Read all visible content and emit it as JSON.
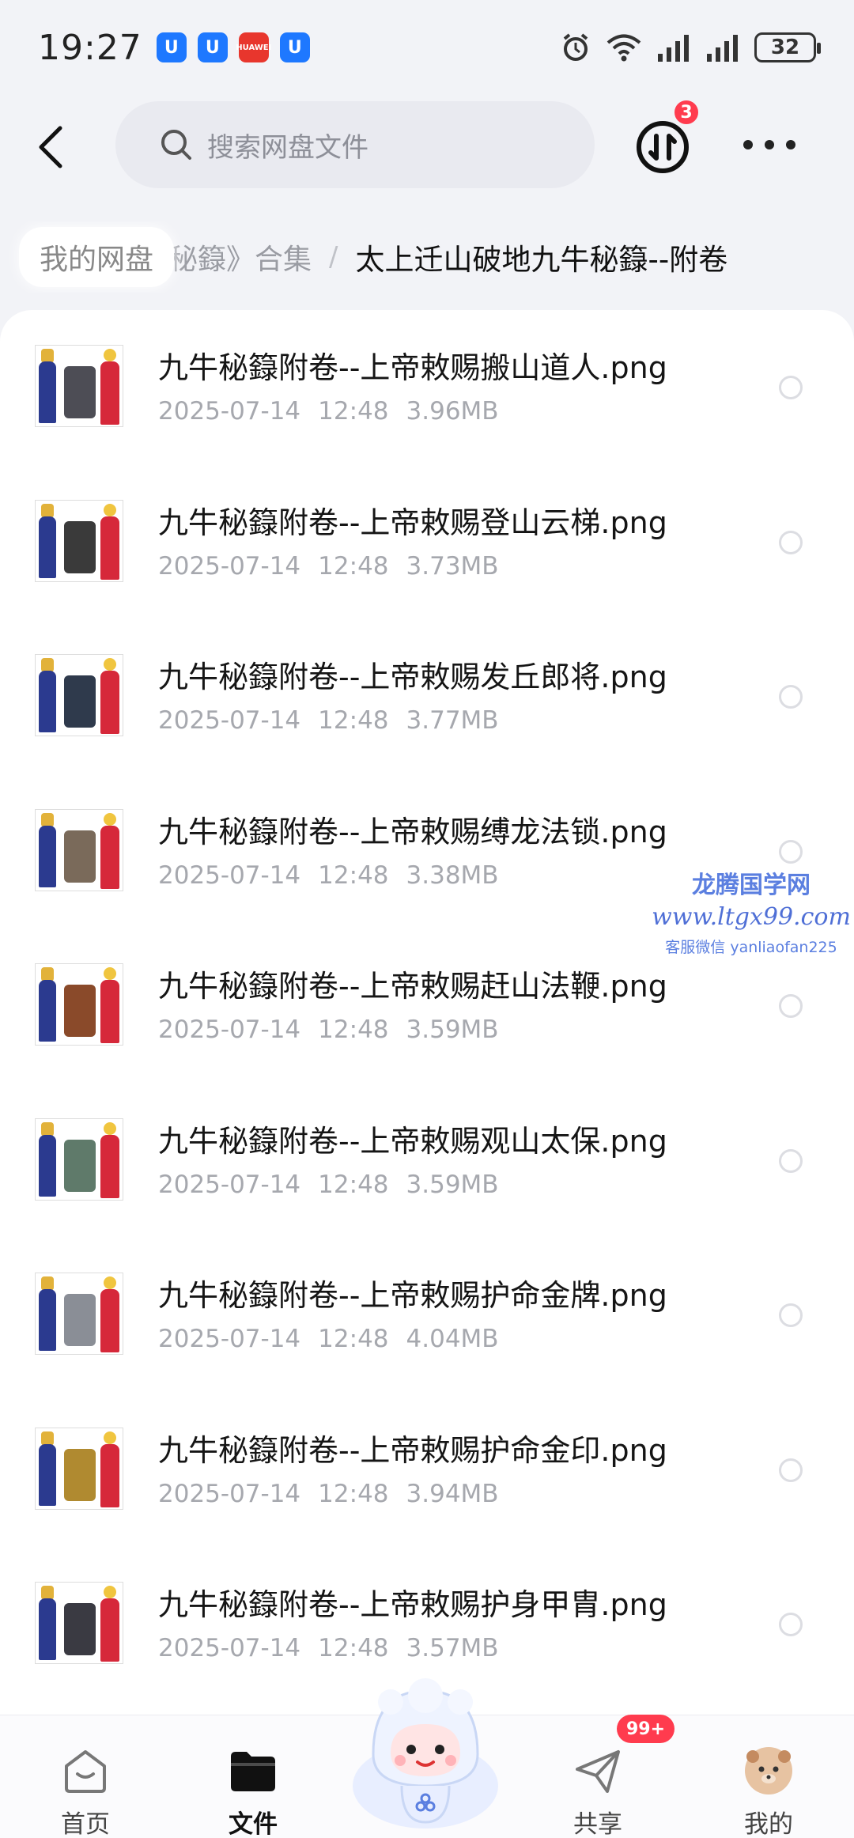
{
  "status_bar": {
    "time": "19:27",
    "battery": "32",
    "notif_labels": [
      "U",
      "U",
      "HUAWEI",
      "U"
    ]
  },
  "search": {
    "placeholder": "搜索网盘文件"
  },
  "transfer": {
    "badge": "3"
  },
  "breadcrumb": {
    "home": "我的网盘",
    "middle": "秘籙》合集",
    "separator": "/",
    "current": "太上迁山破地九牛秘籙--附卷"
  },
  "files": [
    {
      "name": "九牛秘籙附卷--上帝敕赐搬山道人.png",
      "date": "2025-07-14",
      "time": "12:48",
      "size": "3.96MB",
      "obj_color": "#4d4d55"
    },
    {
      "name": "九牛秘籙附卷--上帝敕赐登山云梯.png",
      "date": "2025-07-14",
      "time": "12:48",
      "size": "3.73MB",
      "obj_color": "#3a3a3a"
    },
    {
      "name": "九牛秘籙附卷--上帝敕赐发丘郎将.png",
      "date": "2025-07-14",
      "time": "12:48",
      "size": "3.77MB",
      "obj_color": "#2f3a4c"
    },
    {
      "name": "九牛秘籙附卷--上帝敕赐缚龙法锁.png",
      "date": "2025-07-14",
      "time": "12:48",
      "size": "3.38MB",
      "obj_color": "#7a6a5a"
    },
    {
      "name": "九牛秘籙附卷--上帝敕赐赶山法鞭.png",
      "date": "2025-07-14",
      "time": "12:48",
      "size": "3.59MB",
      "obj_color": "#8a4a2a"
    },
    {
      "name": "九牛秘籙附卷--上帝敕赐观山太保.png",
      "date": "2025-07-14",
      "time": "12:48",
      "size": "3.59MB",
      "obj_color": "#5f7a6a"
    },
    {
      "name": "九牛秘籙附卷--上帝敕赐护命金牌.png",
      "date": "2025-07-14",
      "time": "12:48",
      "size": "4.04MB",
      "obj_color": "#8a8e96"
    },
    {
      "name": "九牛秘籙附卷--上帝敕赐护命金印.png",
      "date": "2025-07-14",
      "time": "12:48",
      "size": "3.94MB",
      "obj_color": "#b08a30"
    },
    {
      "name": "九牛秘籙附卷--上帝敕赐护身甲胄.png",
      "date": "2025-07-14",
      "time": "12:48",
      "size": "3.57MB",
      "obj_color": "#3a3a42"
    }
  ],
  "watermark": {
    "line1": "龙腾国学网",
    "line2": "www.ltgx99.com",
    "line3": "客服微信 yanliaofan225"
  },
  "nav": {
    "home": "首页",
    "files": "文件",
    "share": "共享",
    "mine": "我的",
    "share_badge": "99+"
  },
  "colors": {
    "accent": "#1e78ff",
    "badge": "#ff3b4e"
  }
}
